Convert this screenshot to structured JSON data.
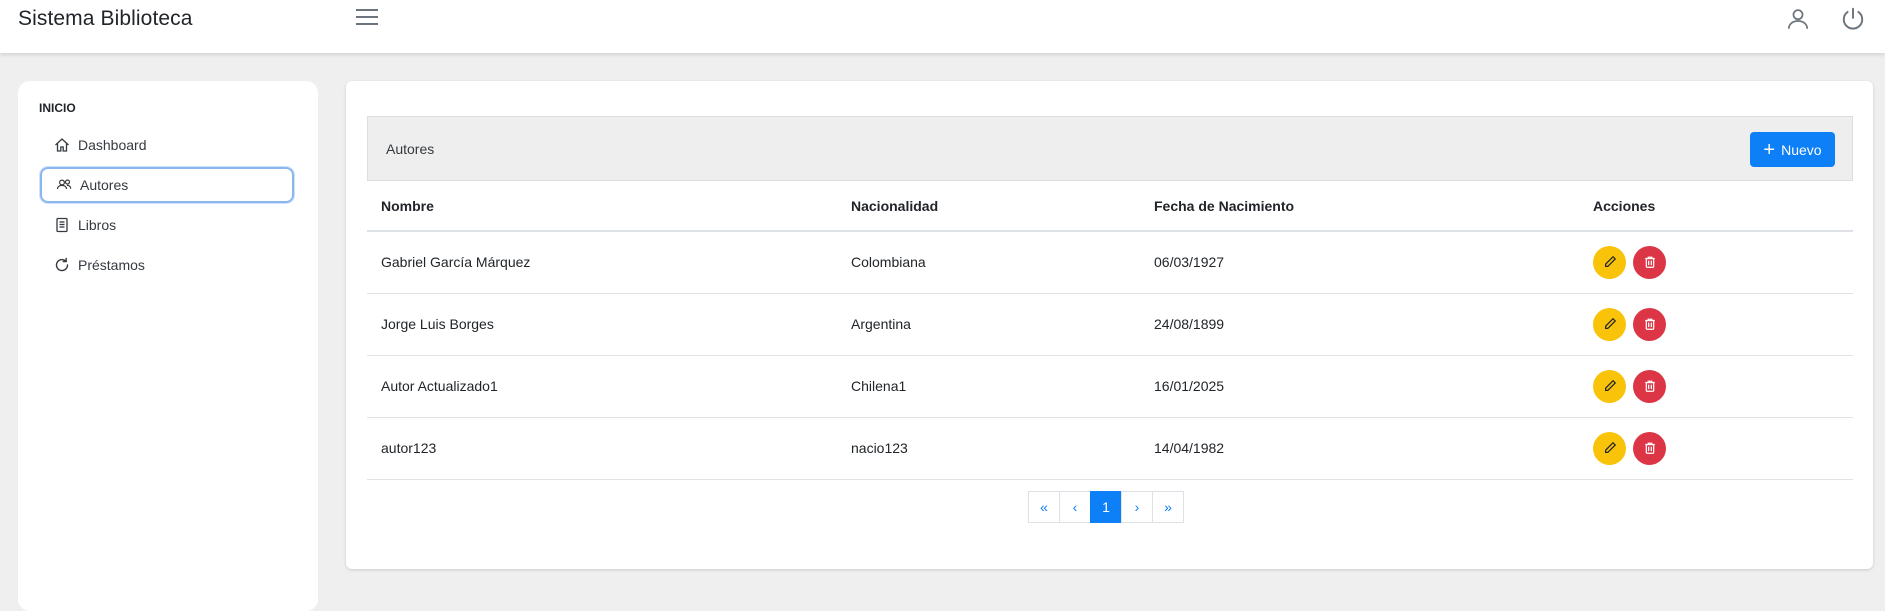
{
  "app": {
    "title": "Sistema Biblioteca"
  },
  "sidebar": {
    "section": "INICIO",
    "items": [
      {
        "label": "Dashboard",
        "icon": "home-icon"
      },
      {
        "label": "Autores",
        "icon": "users-icon"
      },
      {
        "label": "Libros",
        "icon": "book-icon"
      },
      {
        "label": "Préstamos",
        "icon": "refresh-icon"
      }
    ],
    "active": "Autores"
  },
  "card": {
    "title": "Autores",
    "new_button": "Nuevo"
  },
  "table": {
    "headers": [
      "Nombre",
      "Nacionalidad",
      "Fecha de Nacimiento",
      "Acciones"
    ],
    "rows": [
      [
        "Gabriel García Márquez",
        "Colombiana",
        "06/03/1927"
      ],
      [
        "Jorge Luis Borges",
        "Argentina",
        "24/08/1899"
      ],
      [
        "Autor Actualizado1",
        "Chilena1",
        "16/01/2025"
      ],
      [
        "autor123",
        "nacio123",
        "14/04/1982"
      ]
    ]
  },
  "pagination": {
    "first": "«",
    "prev": "‹",
    "current": "1",
    "next": "›",
    "last": "»"
  },
  "colors": {
    "primary": "#0d7ff7",
    "edit": "#f9c30a",
    "delete": "#dc3545"
  }
}
